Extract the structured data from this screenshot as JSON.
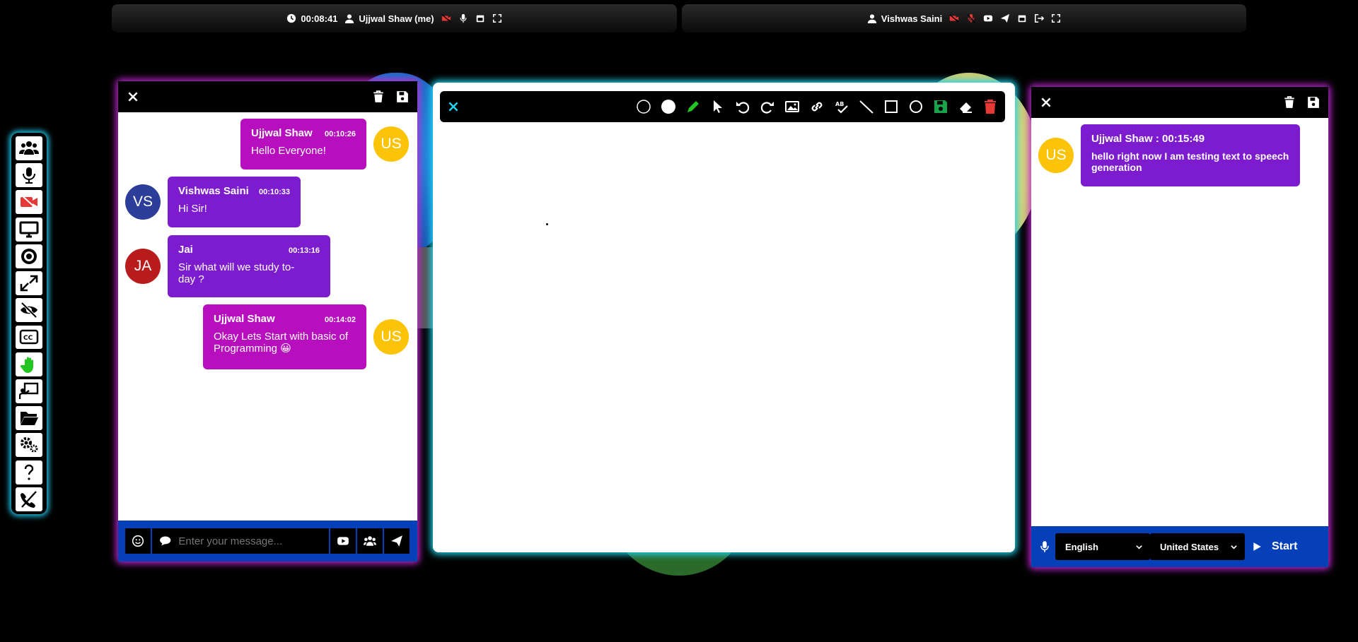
{
  "top_bar_left": {
    "timer": "00:08:41",
    "user": "Ujjwal Shaw (me)"
  },
  "top_bar_right": {
    "user": "Vishwas Saini"
  },
  "chat": {
    "messages": [
      {
        "initials": "US",
        "name": "Ujjwal Shaw",
        "time": "00:10:26",
        "text": "Hello Everyone!"
      },
      {
        "initials": "VS",
        "name": "Vishwas Saini",
        "time": "00:10:33",
        "text": "Hi Sir!"
      },
      {
        "initials": "JA",
        "name": "Jai",
        "time": "00:13:16",
        "text": "Sir what will we study to-day ?"
      },
      {
        "initials": "US",
        "name": "Ujjwal Shaw",
        "time": "00:14:02",
        "text": "Okay Lets Start with basic of Programming 😀"
      }
    ],
    "input_placeholder": "Enter your message..."
  },
  "speech": {
    "message": {
      "initials": "US",
      "header": "Ujjwal Shaw : 00:15:49",
      "text": "hello right now I am testing text to speech generation"
    },
    "language": "English",
    "region": "United States",
    "start_label": "Start"
  },
  "colors": {
    "self_bubble": "#b70fbe",
    "other_bubble": "#7d1ccf",
    "avatar_us": "#fbc408",
    "avatar_vs": "#2c3e9a",
    "avatar_ja": "#b91c1c",
    "footer_blue": "#0540b8"
  }
}
